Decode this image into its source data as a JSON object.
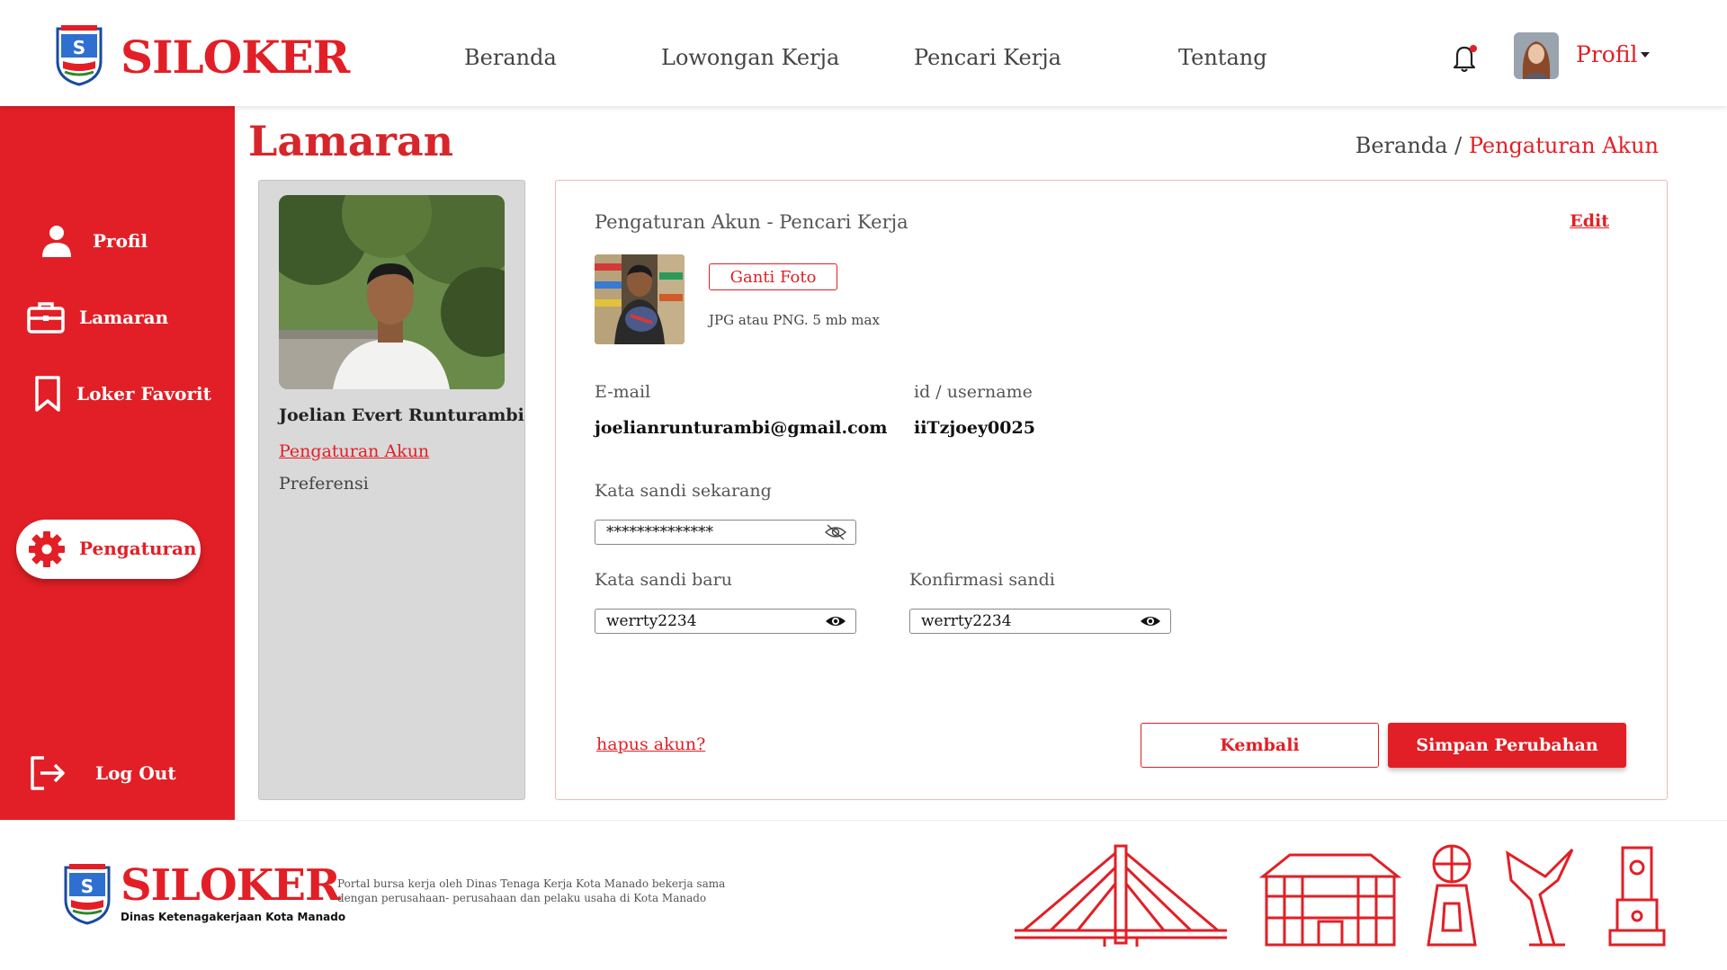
{
  "header": {
    "brand": "SILOKER",
    "nav": [
      "Beranda",
      "Lowongan Kerja",
      "Pencari Kerja",
      "Tentang"
    ],
    "profile_label": "Profil"
  },
  "sidebar": {
    "items": [
      {
        "label": "Profil",
        "icon": "user-icon"
      },
      {
        "label": "Lamaran",
        "icon": "briefcase-icon"
      },
      {
        "label": "Loker Favorit",
        "icon": "bookmark-icon"
      },
      {
        "label": "Pengaturan",
        "icon": "gear-icon",
        "active": true
      }
    ],
    "logout": "Log Out"
  },
  "page": {
    "title": "Lamaran",
    "breadcrumb": {
      "home": "Beranda",
      "separator": "/",
      "current": "Pengaturan Akun"
    }
  },
  "user_panel": {
    "name": "Joelian Evert Runturambi",
    "links": [
      "Pengaturan Akun",
      "Preferensi"
    ]
  },
  "form": {
    "title": "Pengaturan Akun - Pencari Kerja",
    "edit": "Edit",
    "change_photo": "Ganti Foto",
    "photo_hint": "JPG atau PNG. 5 mb max",
    "email_label": "E-mail",
    "email_value": "joelianrunturambi@gmail.com",
    "username_label": "id / username",
    "username_value": "iiTzjoey0025",
    "current_password_label": "Kata sandi sekarang",
    "current_password_value": "**************",
    "new_password_label": "Kata sandi baru",
    "new_password_value": "werrty2234",
    "confirm_password_label": "Konfirmasi sandi",
    "confirm_password_value": "werrty2234",
    "delete_account": "hapus akun?",
    "back": "Kembali",
    "save": "Simpan Perubahan"
  },
  "footer": {
    "brand": "SILOKER",
    "subtitle": "Dinas Ketenagakerjaan Kota Manado",
    "description": "Portal bursa kerja oleh Dinas Tenaga Kerja Kota Manado bekerja sama dengan perusahaan- perusahaan dan pelaku usaha di Kota Manado"
  },
  "colors": {
    "accent": "#e21f26",
    "panel_gray": "#d9d9d9"
  }
}
